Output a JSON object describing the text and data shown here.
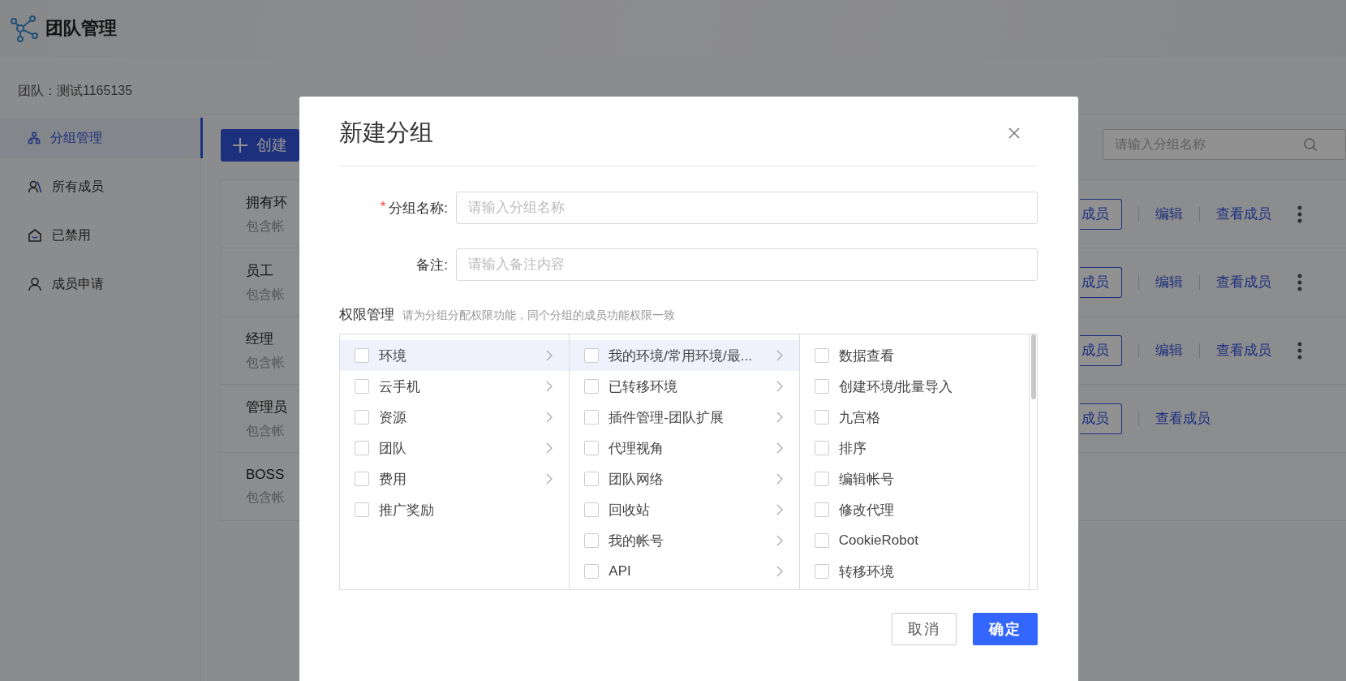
{
  "app": {
    "title": "团队管理"
  },
  "team_label": "团队：测试1165135",
  "sidebar": {
    "items": [
      {
        "label": "分组管理",
        "kind": "groups",
        "selected": true
      },
      {
        "label": "所有成员",
        "kind": "members",
        "selected": false
      },
      {
        "label": "已禁用",
        "kind": "disabled",
        "selected": false
      },
      {
        "label": "成员申请",
        "kind": "apply",
        "selected": false
      }
    ]
  },
  "toolbar": {
    "create_button": "创建",
    "search": {
      "placeholder": "请输入分组名称"
    }
  },
  "groups": [
    {
      "name": "拥有环",
      "subtitle": "包含帐",
      "actions": [
        {
          "label": "成员",
          "kind": "outline"
        },
        {
          "label": "编辑",
          "kind": "link"
        },
        {
          "label": "查看成员",
          "kind": "link"
        }
      ],
      "more": true
    },
    {
      "name": "员工",
      "subtitle": "包含帐",
      "actions": [
        {
          "label": "成员",
          "kind": "outline"
        },
        {
          "label": "编辑",
          "kind": "link"
        },
        {
          "label": "查看成员",
          "kind": "link"
        }
      ],
      "more": true
    },
    {
      "name": "经理",
      "subtitle": "包含帐",
      "actions": [
        {
          "label": "成员",
          "kind": "outline"
        },
        {
          "label": "编辑",
          "kind": "link"
        },
        {
          "label": "查看成员",
          "kind": "link"
        }
      ],
      "more": true
    },
    {
      "name": "管理员",
      "subtitle": "包含帐",
      "actions": [
        {
          "label": "成员",
          "kind": "outline"
        },
        {
          "label": "查看成员",
          "kind": "link"
        }
      ],
      "more": false
    },
    {
      "name": "BOSS",
      "subtitle": "包含帐",
      "more": false
    }
  ],
  "dialog": {
    "title": "新建分组",
    "fields": [
      {
        "label": "分组名称:",
        "required_mark": "*",
        "placeholder": "请输入分组名称"
      },
      {
        "label": "备注:",
        "placeholder": "请输入备注内容"
      }
    ],
    "permissions": {
      "title": "权限管理",
      "hint": "请为分组分配权限功能，同个分组的成员功能权限一致",
      "columns": [
        {
          "items": [
            {
              "label": "环境",
              "checked": false,
              "selected": true,
              "expandable": true
            },
            {
              "label": "云手机",
              "checked": false,
              "selected": false,
              "expandable": true
            },
            {
              "label": "资源",
              "checked": false,
              "selected": false,
              "expandable": true
            },
            {
              "label": "团队",
              "checked": false,
              "selected": false,
              "expandable": true
            },
            {
              "label": "费用",
              "checked": false,
              "selected": false,
              "expandable": true
            },
            {
              "label": "推广奖励",
              "checked": false,
              "selected": false,
              "expandable": false
            }
          ]
        },
        {
          "items": [
            {
              "label": "我的环境/常用环境/最...",
              "checked": false,
              "selected": true,
              "expandable": true
            },
            {
              "label": "已转移环境",
              "checked": false,
              "selected": false,
              "expandable": true
            },
            {
              "label": "插件管理-团队扩展",
              "checked": false,
              "selected": false,
              "expandable": true
            },
            {
              "label": "代理视角",
              "checked": false,
              "selected": false,
              "expandable": true
            },
            {
              "label": "团队网络",
              "checked": false,
              "selected": false,
              "expandable": true
            },
            {
              "label": "回收站",
              "checked": false,
              "selected": false,
              "expandable": true
            },
            {
              "label": "我的帐号",
              "checked": false,
              "selected": false,
              "expandable": true
            },
            {
              "label": "API",
              "checked": false,
              "selected": false,
              "expandable": true
            }
          ]
        },
        {
          "items": [
            {
              "label": "数据查看",
              "checked": false,
              "selected": false,
              "expandable": false
            },
            {
              "label": "创建环境/批量导入",
              "checked": false,
              "selected": false,
              "expandable": false
            },
            {
              "label": "九宫格",
              "checked": false,
              "selected": false,
              "expandable": false
            },
            {
              "label": "排序",
              "checked": false,
              "selected": false,
              "expandable": false
            },
            {
              "label": "编辑帐号",
              "checked": false,
              "selected": false,
              "expandable": false
            },
            {
              "label": "修改代理",
              "checked": false,
              "selected": false,
              "expandable": false
            },
            {
              "label": "CookieRobot",
              "checked": false,
              "selected": false,
              "expandable": false
            },
            {
              "label": "转移环境",
              "checked": false,
              "selected": false,
              "expandable": false
            }
          ]
        }
      ]
    },
    "buttons": [
      {
        "label": "取消",
        "kind": "default"
      },
      {
        "label": "确定",
        "kind": "primary"
      }
    ]
  }
}
